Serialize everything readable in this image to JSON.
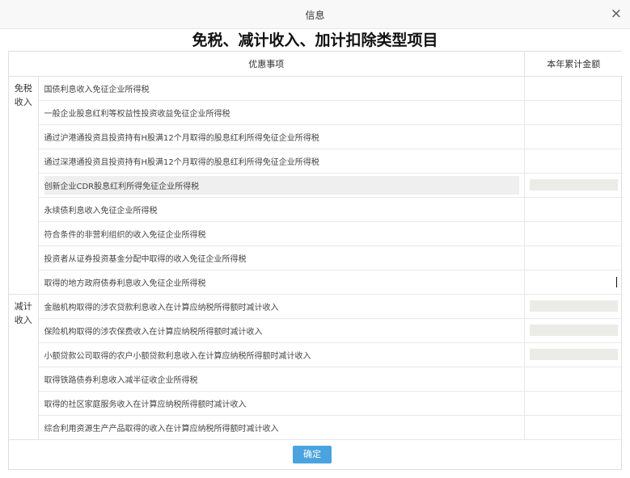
{
  "dialog": {
    "title": "信息",
    "close_glyph": "×",
    "heading": "免税、减计收入、加计扣除类型项目"
  },
  "table": {
    "header": {
      "item": "优惠事项",
      "amount": "本年累计金额"
    },
    "exempt": {
      "category": "免税收入",
      "rows": [
        {
          "label": "国债利息收入免征企业所得税"
        },
        {
          "label": "一般企业股息红利等权益性投资收益免征企业所得税"
        },
        {
          "label": "通过沪港通投资且投资持有H股满12个月取得的股息红利所得免征企业所得税"
        },
        {
          "label": "通过深港通投资且投资持有H股满12个月取得的股息红利所得免征企业所得税"
        },
        {
          "label": "创新企业CDR股息红利所得免征企业所得税"
        },
        {
          "label": "永续债利息收入免征企业所得税"
        },
        {
          "label": "符合条件的非营利组织的收入免征企业所得税"
        },
        {
          "label": "投资者从证券投资基金分配中取得的收入免征企业所得税"
        },
        {
          "label": "取得的地方政府债券利息收入免征企业所得税"
        }
      ]
    },
    "reduced": {
      "category": "减计收入",
      "rows": [
        {
          "label": "金融机构取得的涉农贷款利息收入在计算应纳税所得额时减计收入"
        },
        {
          "label": "保险机构取得的涉农保费收入在计算应纳税所得额时减计收入"
        },
        {
          "label": "小额贷款公司取得的农户小额贷款利息收入在计算应纳税所得额时减计收入"
        },
        {
          "label": "取得铁路债券利息收入减半征收企业所得税"
        },
        {
          "label": "取得的社区家庭服务收入在计算应纳税所得额时减计收入"
        },
        {
          "label": "综合利用资源生产产品取得的收入在计算应纳税所得额时减计收入"
        }
      ]
    }
  },
  "footer": {
    "ok_label": "确定"
  }
}
